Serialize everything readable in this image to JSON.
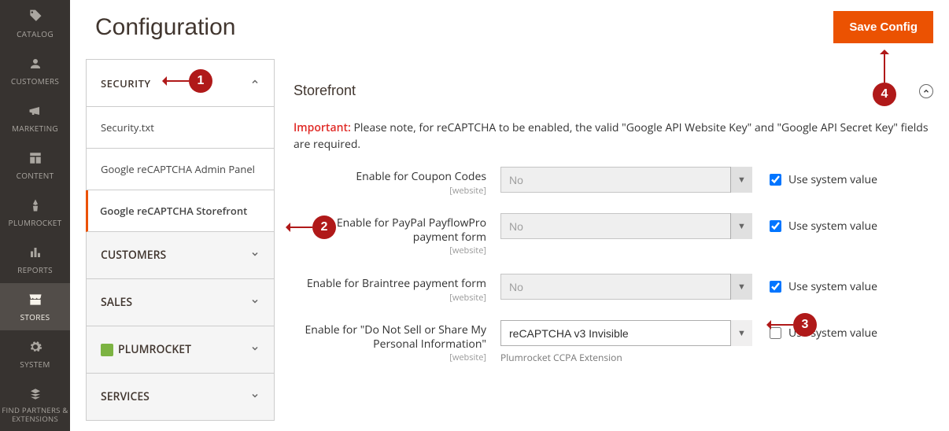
{
  "nav": {
    "items": [
      {
        "label": "CATALOG"
      },
      {
        "label": "CUSTOMERS"
      },
      {
        "label": "MARKETING"
      },
      {
        "label": "CONTENT"
      },
      {
        "label": "PLUMROCKET"
      },
      {
        "label": "REPORTS"
      },
      {
        "label": "STORES"
      },
      {
        "label": "SYSTEM"
      },
      {
        "label": "FIND PARTNERS & EXTENSIONS"
      }
    ],
    "active_index": 6
  },
  "header": {
    "title": "Configuration",
    "save_button": "Save Config"
  },
  "sidebar": {
    "groups": [
      {
        "label": "SECURITY",
        "open": true,
        "items": [
          {
            "label": "Security.txt"
          },
          {
            "label": "Google reCAPTCHA Admin Panel"
          },
          {
            "label": "Google reCAPTCHA Storefront",
            "active": true
          }
        ]
      },
      {
        "label": "CUSTOMERS",
        "open": false
      },
      {
        "label": "SALES",
        "open": false
      },
      {
        "label": "PLUMROCKET",
        "open": false,
        "logo": true
      },
      {
        "label": "SERVICES",
        "open": false
      }
    ]
  },
  "content": {
    "section_title": "Storefront",
    "note_imp": "Important:",
    "note_text": " Please note, for reCAPTCHA to be enabled, the valid \"Google API Website Key\" and \"Google API Secret Key\" fields are required.",
    "scope_label": "[website]",
    "use_system_label": "Use system value",
    "fields": [
      {
        "label": "Enable for Coupon Codes",
        "value": "No",
        "disabled": true,
        "use_system": true
      },
      {
        "label": "Enable for PayPal PayflowPro payment form",
        "value": "No",
        "disabled": true,
        "use_system": true
      },
      {
        "label": "Enable for Braintree payment form",
        "value": "No",
        "disabled": true,
        "use_system": true
      },
      {
        "label": "Enable for \"Do Not Sell or Share My Personal Information\"",
        "value": "reCAPTCHA v3 Invisible",
        "disabled": false,
        "use_system": false,
        "helper": "Plumrocket CCPA Extension"
      }
    ]
  },
  "markers": {
    "m1": "1",
    "m2": "2",
    "m3": "3",
    "m4": "4"
  }
}
